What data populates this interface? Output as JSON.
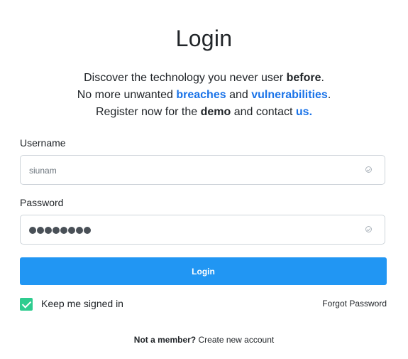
{
  "title": "Login",
  "intro": {
    "line1_text": "Discover the technology you never user ",
    "line1_bold": "before",
    "line1_end": ".",
    "line2_text": "No more unwanted ",
    "line2_link1": "breaches",
    "line2_mid": " and ",
    "line2_link2": "vulnerabilities",
    "line2_end": ".",
    "line3_text": "Register now for the ",
    "line3_bold": "demo",
    "line3_mid": " and contact ",
    "line3_link": "us."
  },
  "form": {
    "username_label": "Username",
    "username_value": "siunam",
    "password_label": "Password",
    "password_mask_count": 8,
    "login_label": "Login",
    "keep_signed_in_label": "Keep me signed in",
    "keep_signed_in_checked": true,
    "forgot_label": "Forgot Password"
  },
  "footer": {
    "question": "Not a member?",
    "create_link": "Create new account"
  },
  "colors": {
    "accent": "#2196f3",
    "link": "#1a73e8",
    "checkbox": "#2ecc8f"
  },
  "icons": {
    "username_status": "check-circle-icon",
    "password_status": "check-circle-icon",
    "checkbox_mark": "checkmark-icon"
  }
}
